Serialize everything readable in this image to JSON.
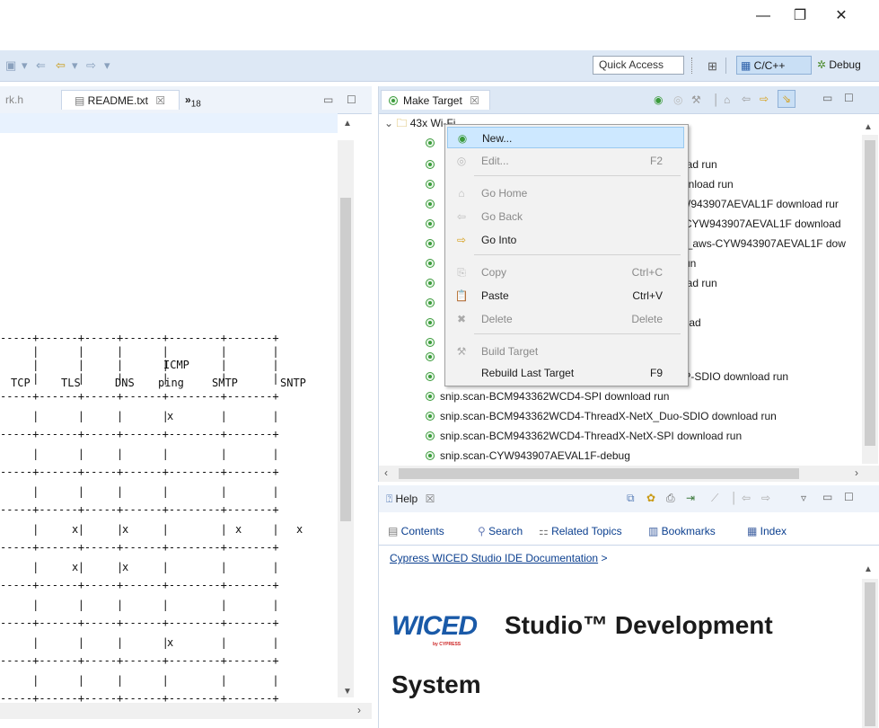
{
  "window": {
    "minimize_glyph": "—",
    "restore_glyph": "❐",
    "close_glyph": "✕"
  },
  "toolbar": {
    "quick_access": "Quick Access",
    "perspective_cc": "C/C++",
    "perspective_debug": "Debug"
  },
  "editor": {
    "tab_partial": "rk.h",
    "tab_active": "README.txt",
    "tab_close": "☒",
    "overflow": "»",
    "overflow_count": "18",
    "table_headers": [
      "TCP",
      "TLS",
      "DNS",
      "ICMP",
      "ping",
      "SMTP",
      "SNTP"
    ],
    "cell_x": "x"
  },
  "make_target": {
    "title": "Make Target",
    "close": "☒",
    "project_label": "43x",
    "project_label_tail": "Wi-Fi",
    "items": [
      "",
      "oad run",
      "wnload run",
      "W943907AEVAL1F download rur",
      "-CYW943907AEVAL1F download",
      "e_aws-CYW943907AEVAL1F dow",
      "run",
      "oad run",
      "",
      "load",
      "",
      "n",
      "IP-SDIO download run",
      "snip.scan-BCM943362WCD4-SPI download run",
      "snip.scan-BCM943362WCD4-ThreadX-NetX_Duo-SDIO download run",
      "snip.scan-BCM943362WCD4-ThreadX-NetX-SPI download run",
      "snip.scan-CYW943907AEVAL1F-debug"
    ]
  },
  "context_menu": {
    "new": "New...",
    "edit": "Edit...",
    "edit_shortcut": "F2",
    "go_home": "Go Home",
    "go_back": "Go Back",
    "go_into": "Go Into",
    "copy": "Copy",
    "copy_shortcut": "Ctrl+C",
    "paste": "Paste",
    "paste_shortcut": "Ctrl+V",
    "delete": "Delete",
    "delete_shortcut": "Delete",
    "build_target": "Build Target",
    "rebuild_last": "Rebuild Last Target",
    "rebuild_shortcut": "F9"
  },
  "help": {
    "title": "Help",
    "close": "☒",
    "contents": "Contents",
    "search": "Search",
    "related": "Related Topics",
    "bookmarks": "Bookmarks",
    "index": "Index",
    "breadcrumb": "Cypress WICED Studio IDE Documentation",
    "breadcrumb_sep": ">",
    "logo_text": "WICED",
    "logo_sub": "by CYPRESS",
    "heading_line1": "Studio™ Development",
    "heading_line2": "System"
  },
  "colors": {
    "accent_blue": "#cce4f7",
    "menu_highlight": "#cde8ff",
    "wiced_blue": "#1a5aa8"
  }
}
